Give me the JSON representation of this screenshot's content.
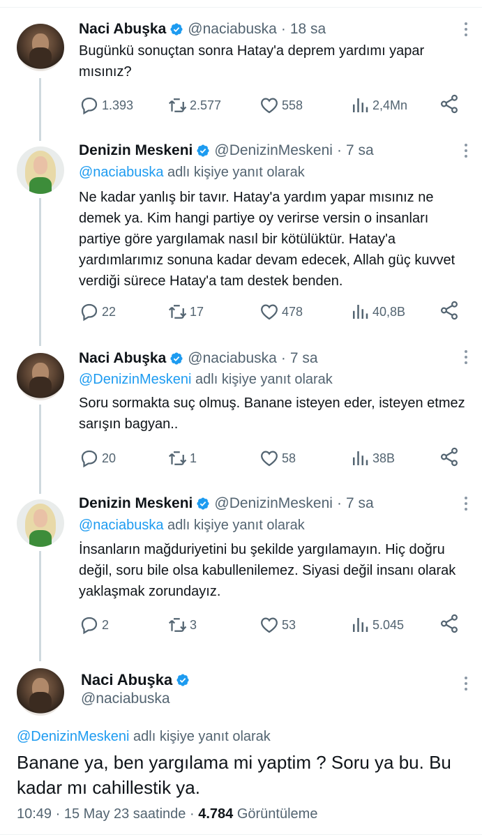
{
  "colors": {
    "link": "#1d9bf0",
    "secondary": "#536471",
    "text": "#0f1419",
    "thread_line": "#cfd9de"
  },
  "icons": {
    "verified": "verified-badge-icon",
    "reply": "reply-icon",
    "retweet": "retweet-icon",
    "like": "heart-icon",
    "views": "views-icon",
    "share": "share-icon",
    "more": "more-icon"
  },
  "tweets": [
    {
      "name": "Naci Abuşka",
      "handle": "@naciabuska",
      "separator": "·",
      "time": "18 sa",
      "reply_to_handle": "",
      "reply_to_suffix": "",
      "text": "Bugünkü sonuçtan sonra Hatay'a deprem yardımı yapar mısınız?",
      "replies": "1.393",
      "retweets": "2.577",
      "likes": "558",
      "views": "2,4Mn"
    },
    {
      "name": "Denizin Meskeni",
      "handle": "@DenizinMeskeni",
      "separator": "·",
      "time": "7 sa",
      "reply_to_handle": "@naciabuska",
      "reply_to_suffix": "adlı kişiye yanıt olarak",
      "text": "Ne kadar yanlış bir tavır. Hatay'a yardım yapar mısınız ne demek ya. Kim hangi partiye oy verirse versin o insanları partiye göre yargılamak nasıl bir kötülüktür. Hatay'a yardımlarımız sonuna kadar devam edecek, Allah güç kuvvet verdiği sürece Hatay'a tam destek benden.",
      "replies": "22",
      "retweets": "17",
      "likes": "478",
      "views": "40,8B"
    },
    {
      "name": "Naci Abuşka",
      "handle": "@naciabuska",
      "separator": "·",
      "time": "7 sa",
      "reply_to_handle": "@DenizinMeskeni",
      "reply_to_suffix": "adlı kişiye yanıt olarak",
      "text": "Soru sormakta suç olmuş. Banane isteyen eder, isteyen etmez sarışın bagyan..",
      "replies": "20",
      "retweets": "1",
      "likes": "58",
      "views": "38B"
    },
    {
      "name": "Denizin Meskeni",
      "handle": "@DenizinMeskeni",
      "separator": "·",
      "time": "7 sa",
      "reply_to_handle": "@naciabuska",
      "reply_to_suffix": "adlı kişiye yanıt olarak",
      "text": "İnsanların mağduriyetini bu şekilde yargılamayın. Hiç doğru değil, soru bile olsa kabullenilemez. Siyasi değil insanı olarak yaklaşmak zorundayız.",
      "replies": "2",
      "retweets": "3",
      "likes": "53",
      "views": "5.045"
    }
  ],
  "main_tweet": {
    "name": "Naci Abuşka",
    "handle": "@naciabuska",
    "reply_to_handle": "@DenizinMeskeni",
    "reply_to_suffix": "adlı kişiye yanıt olarak",
    "text": "Banane ya, ben yargılama mi yaptim ? Soru ya bu. Bu kadar mı cahillestik ya.",
    "time": "10:49",
    "date": "15 May 23 saatinde",
    "separator": "·",
    "views_count": "4.784",
    "views_label": "Görüntüleme"
  }
}
